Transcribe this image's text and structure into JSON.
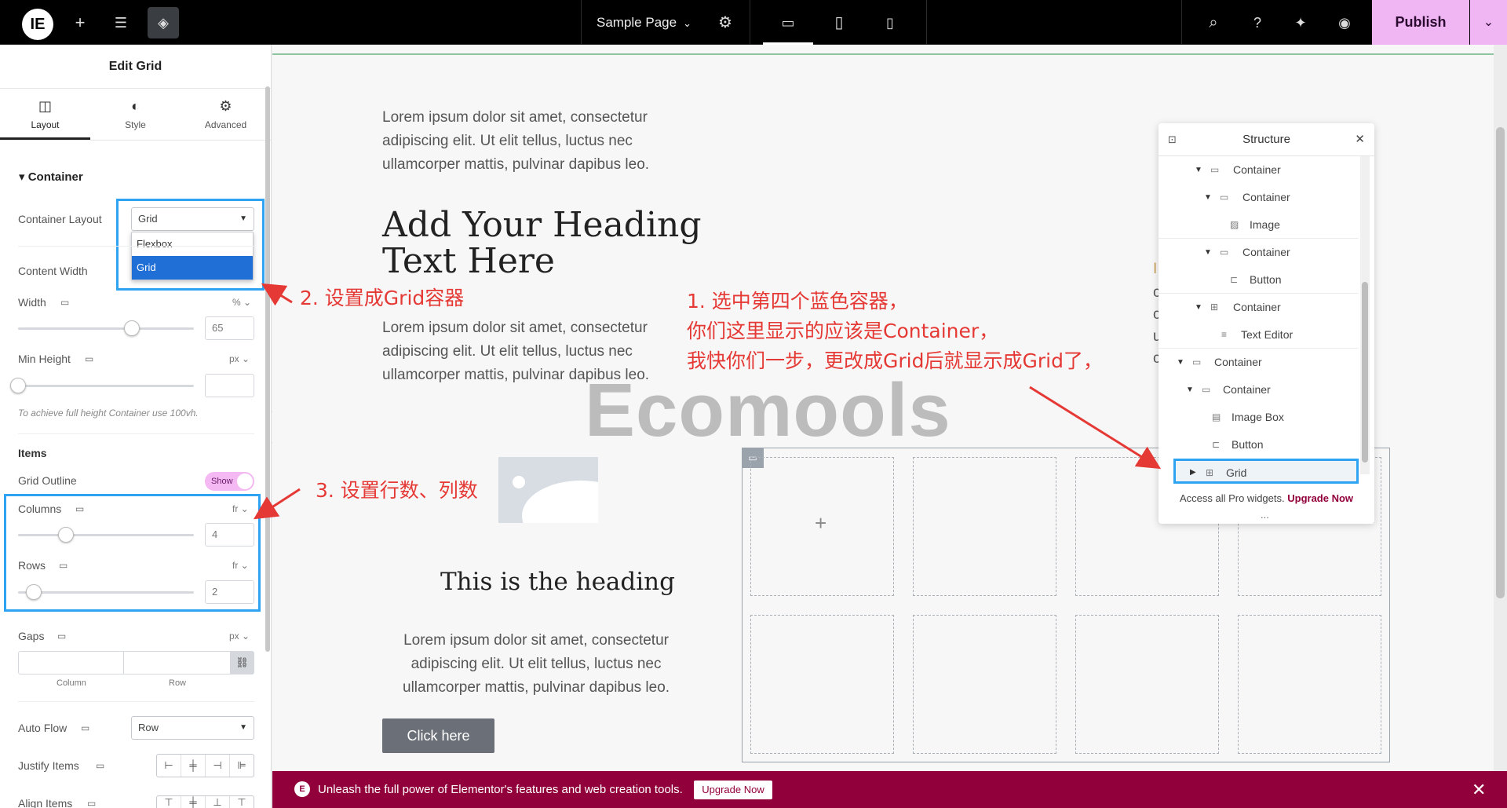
{
  "topbar": {
    "page_title": "Sample Page",
    "publish_label": "Publish"
  },
  "panel": {
    "title": "Edit Grid",
    "tabs": [
      {
        "label": "Layout"
      },
      {
        "label": "Style"
      },
      {
        "label": "Advanced"
      }
    ],
    "section": "Container",
    "container_layout": {
      "label": "Container Layout",
      "value": "Grid",
      "options": [
        "Flexbox",
        "Grid"
      ]
    },
    "content_width_label": "Content Width",
    "width": {
      "label": "Width",
      "unit": "%",
      "value": "65"
    },
    "min_height": {
      "label": "Min Height",
      "unit": "px",
      "value": ""
    },
    "hint": "To achieve full height Container use 100vh.",
    "items_title": "Items",
    "grid_outline": {
      "label": "Grid Outline",
      "toggle": "Show"
    },
    "columns": {
      "label": "Columns",
      "unit": "fr",
      "value": "4"
    },
    "rows": {
      "label": "Rows",
      "unit": "fr",
      "value": "2"
    },
    "gaps": {
      "label": "Gaps",
      "unit": "px",
      "column_label": "Column",
      "row_label": "Row"
    },
    "auto_flow": {
      "label": "Auto Flow",
      "value": "Row"
    },
    "justify_items_label": "Justify Items",
    "align_items_label": "Align Items"
  },
  "canvas": {
    "para1": [
      "Lorem ipsum dolor sit amet, consectetur",
      "adipiscing elit. Ut elit tellus, luctus nec",
      "ullamcorper mattis, pulvinar dapibus leo."
    ],
    "heading": [
      "Add Your Heading",
      "Text Here"
    ],
    "para2": [
      "Lorem ipsum dolor sit amet, consectetur",
      "adipiscing elit. Ut elit tellus, luctus nec",
      "ullamcorper mattis, pulvinar dapibus leo."
    ],
    "watermark": "Ecomools",
    "heading2": "This is the heading",
    "para3": [
      "Lorem ipsum dolor sit amet, consectetur",
      "adipiscing elit. Ut elit tellus, luctus nec",
      "ullamcorper mattis, pulvinar dapibus leo."
    ],
    "button_label": "Click here"
  },
  "structure": {
    "title": "Structure",
    "items": [
      {
        "label": "Container"
      },
      {
        "label": "Container"
      },
      {
        "label": "Image"
      },
      {
        "label": "Container"
      },
      {
        "label": "Button"
      },
      {
        "label": "Container"
      },
      {
        "label": "Text Editor"
      },
      {
        "label": "Container"
      },
      {
        "label": "Container"
      },
      {
        "label": "Image Box"
      },
      {
        "label": "Button"
      },
      {
        "label": "Grid"
      }
    ],
    "footer_text": "Access all Pro widgets.",
    "footer_link": "Upgrade Now",
    "more": "..."
  },
  "annotations": {
    "a1": [
      "1. 选中第四个蓝色容器，",
      "你们这里显示的应该是Container，",
      "我快你们一步，更改成Grid后就显示成Grid了，"
    ],
    "a2": "2. 设置成Grid容器",
    "a3": "3. 设置行数、列数"
  },
  "banner": {
    "text": "Unleash the full power of Elementor's features and web creation tools.",
    "button": "Upgrade Now"
  },
  "colors": {
    "publish": "#f0b6f3",
    "banner": "#92003b",
    "highlight": "#2ea3f2",
    "annotation": "#e53935"
  }
}
